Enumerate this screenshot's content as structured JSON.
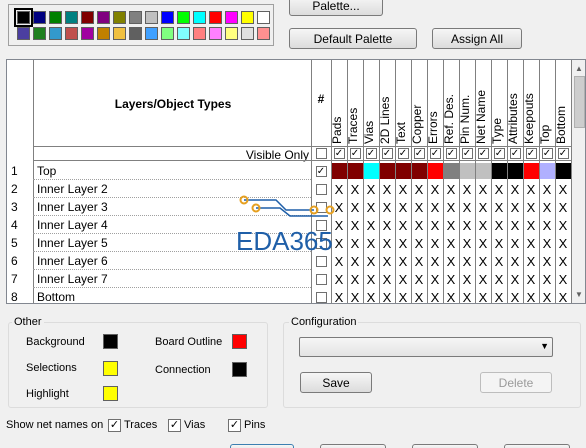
{
  "palette": {
    "swatches_row1": [
      "#000000",
      "#000080",
      "#008000",
      "#008080",
      "#800000",
      "#800080",
      "#808000",
      "#808080",
      "#c0c0c0",
      "#0000ff",
      "#00ff00",
      "#00ffff",
      "#ff0000",
      "#ff00ff",
      "#ffff00",
      "#ffffff"
    ],
    "swatches_row2": [
      "#4b3fa0",
      "#1f7f1f",
      "#3399cc",
      "#c0504d",
      "#a000a0",
      "#c08000",
      "#f0c040",
      "#606060",
      "#40a0ff",
      "#80ff80",
      "#80ffff",
      "#ff8080",
      "#ff80ff",
      "#ffff80",
      "#e0e0e0",
      "#ff9090"
    ],
    "selected_index": 0
  },
  "buttons": {
    "palette": "Palette...",
    "default_palette": "Default Palette",
    "assign_all": "Assign All",
    "save": "Save",
    "delete": "Delete"
  },
  "grid": {
    "header_title": "Layers/Object Types",
    "hash": "#",
    "visible_only": "Visible Only",
    "columns": [
      "Pads",
      "Traces",
      "Vias",
      "2D Lines",
      "Text",
      "Copper",
      "Errors",
      "Ref. Des.",
      "Pin Num.",
      "Net Name",
      "Type",
      "Attributes",
      "Keepouts",
      "Top",
      "Bottom"
    ],
    "top_colors": [
      "#800000",
      "#800000",
      "#00ffff",
      "#800000",
      "#800000",
      "#800000",
      "#ff0000",
      "#808080",
      "#c0c0c0",
      "#c0c0c0",
      "#000000",
      "#000000",
      "#ff0000",
      "#b0b0ff",
      "#000000"
    ],
    "x_mark": "X",
    "check_mark": "✓",
    "rows": [
      {
        "num": "1",
        "name": "Top"
      },
      {
        "num": "2",
        "name": "Inner Layer 2"
      },
      {
        "num": "3",
        "name": "Inner Layer 3"
      },
      {
        "num": "4",
        "name": "Inner Layer 4"
      },
      {
        "num": "5",
        "name": "Inner Layer 5"
      },
      {
        "num": "6",
        "name": "Inner Layer 6"
      },
      {
        "num": "7",
        "name": "Inner Layer 7"
      },
      {
        "num": "8",
        "name": "Bottom"
      }
    ]
  },
  "other": {
    "title": "Other",
    "background": "Background",
    "background_color": "#000000",
    "selections": "Selections",
    "selections_color": "#ffff00",
    "highlight": "Highlight",
    "highlight_color": "#ffff00",
    "board_outline": "Board Outline",
    "board_outline_color": "#ff0000",
    "connection": "Connection",
    "connection_color": "#000000"
  },
  "configuration": {
    "title": "Configuration",
    "selected_value": ""
  },
  "net_names": {
    "label": "Show net names on",
    "traces": "Traces",
    "vias": "Vias",
    "pins": "Pins"
  },
  "watermark": {
    "text": "EDA365"
  }
}
